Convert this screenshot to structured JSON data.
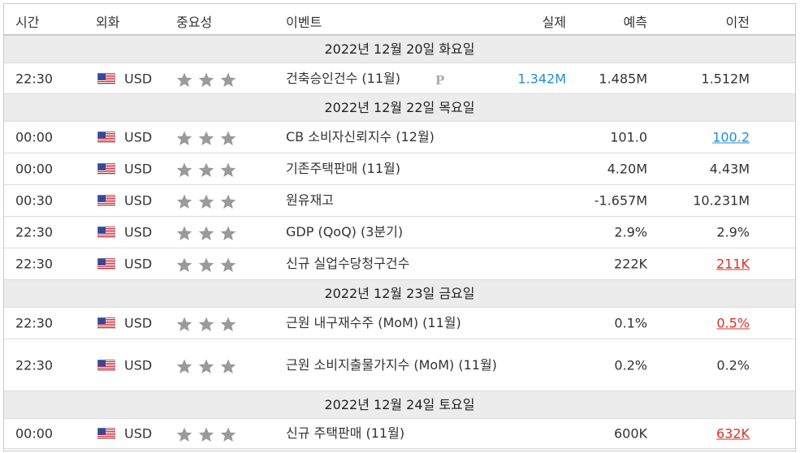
{
  "header": {
    "time": "시간",
    "currency": "외화",
    "importance": "중요성",
    "event": "이벤트",
    "actual": "실제",
    "forecast": "예측",
    "previous": "이전"
  },
  "colors": {
    "up": "#1f8ed6",
    "down": "#d93025",
    "star": "#9a9a9a",
    "date_bg": "#ececec"
  },
  "groups": [
    {
      "date": "2022년 12월 20일 화요일",
      "events": [
        {
          "time": "22:30",
          "currency": "USD",
          "flag_icon": "us-flag-icon",
          "stars": 3,
          "event": "건축승인건수 (11월)",
          "marker": "P",
          "actual": "1.342M",
          "forecast": "1.485M",
          "previous": "1.512M",
          "actual_trend": "up"
        }
      ]
    },
    {
      "date": "2022년 12월 22일 목요일",
      "events": [
        {
          "time": "00:00",
          "currency": "USD",
          "flag_icon": "us-flag-icon",
          "stars": 3,
          "event": "CB 소비자신뢰지수 (12월)",
          "actual": "",
          "forecast": "101.0",
          "previous": "100.2",
          "previous_trend": "up"
        },
        {
          "time": "00:00",
          "currency": "USD",
          "flag_icon": "us-flag-icon",
          "stars": 3,
          "event": "기존주택판매 (11월)",
          "actual": "",
          "forecast": "4.20M",
          "previous": "4.43M"
        },
        {
          "time": "00:30",
          "currency": "USD",
          "flag_icon": "us-flag-icon",
          "stars": 3,
          "event": "원유재고",
          "actual": "",
          "forecast": "-1.657M",
          "previous": "10.231M"
        },
        {
          "time": "22:30",
          "currency": "USD",
          "flag_icon": "us-flag-icon",
          "stars": 3,
          "event": "GDP (QoQ) (3분기)",
          "actual": "",
          "forecast": "2.9%",
          "previous": "2.9%"
        },
        {
          "time": "22:30",
          "currency": "USD",
          "flag_icon": "us-flag-icon",
          "stars": 3,
          "event": "신규 실업수당청구건수",
          "actual": "",
          "forecast": "222K",
          "previous": "211K",
          "previous_trend": "down"
        }
      ]
    },
    {
      "date": "2022년 12월 23일 금요일",
      "events": [
        {
          "time": "22:30",
          "currency": "USD",
          "flag_icon": "us-flag-icon",
          "stars": 3,
          "event": "근원 내구재수주 (MoM) (11월)",
          "actual": "",
          "forecast": "0.1%",
          "previous": "0.5%",
          "previous_trend": "down"
        },
        {
          "time": "22:30",
          "currency": "USD",
          "flag_icon": "us-flag-icon",
          "stars": 3,
          "event": "근원 소비지출물가지수 (MoM) (11월)",
          "actual": "",
          "forecast": "0.2%",
          "previous": "0.2%"
        }
      ]
    },
    {
      "date": "2022년 12월 24일 토요일",
      "events": [
        {
          "time": "00:00",
          "currency": "USD",
          "flag_icon": "us-flag-icon",
          "stars": 3,
          "event": "신규 주택판매 (11월)",
          "actual": "",
          "forecast": "600K",
          "previous": "632K",
          "previous_trend": "down"
        }
      ]
    }
  ]
}
